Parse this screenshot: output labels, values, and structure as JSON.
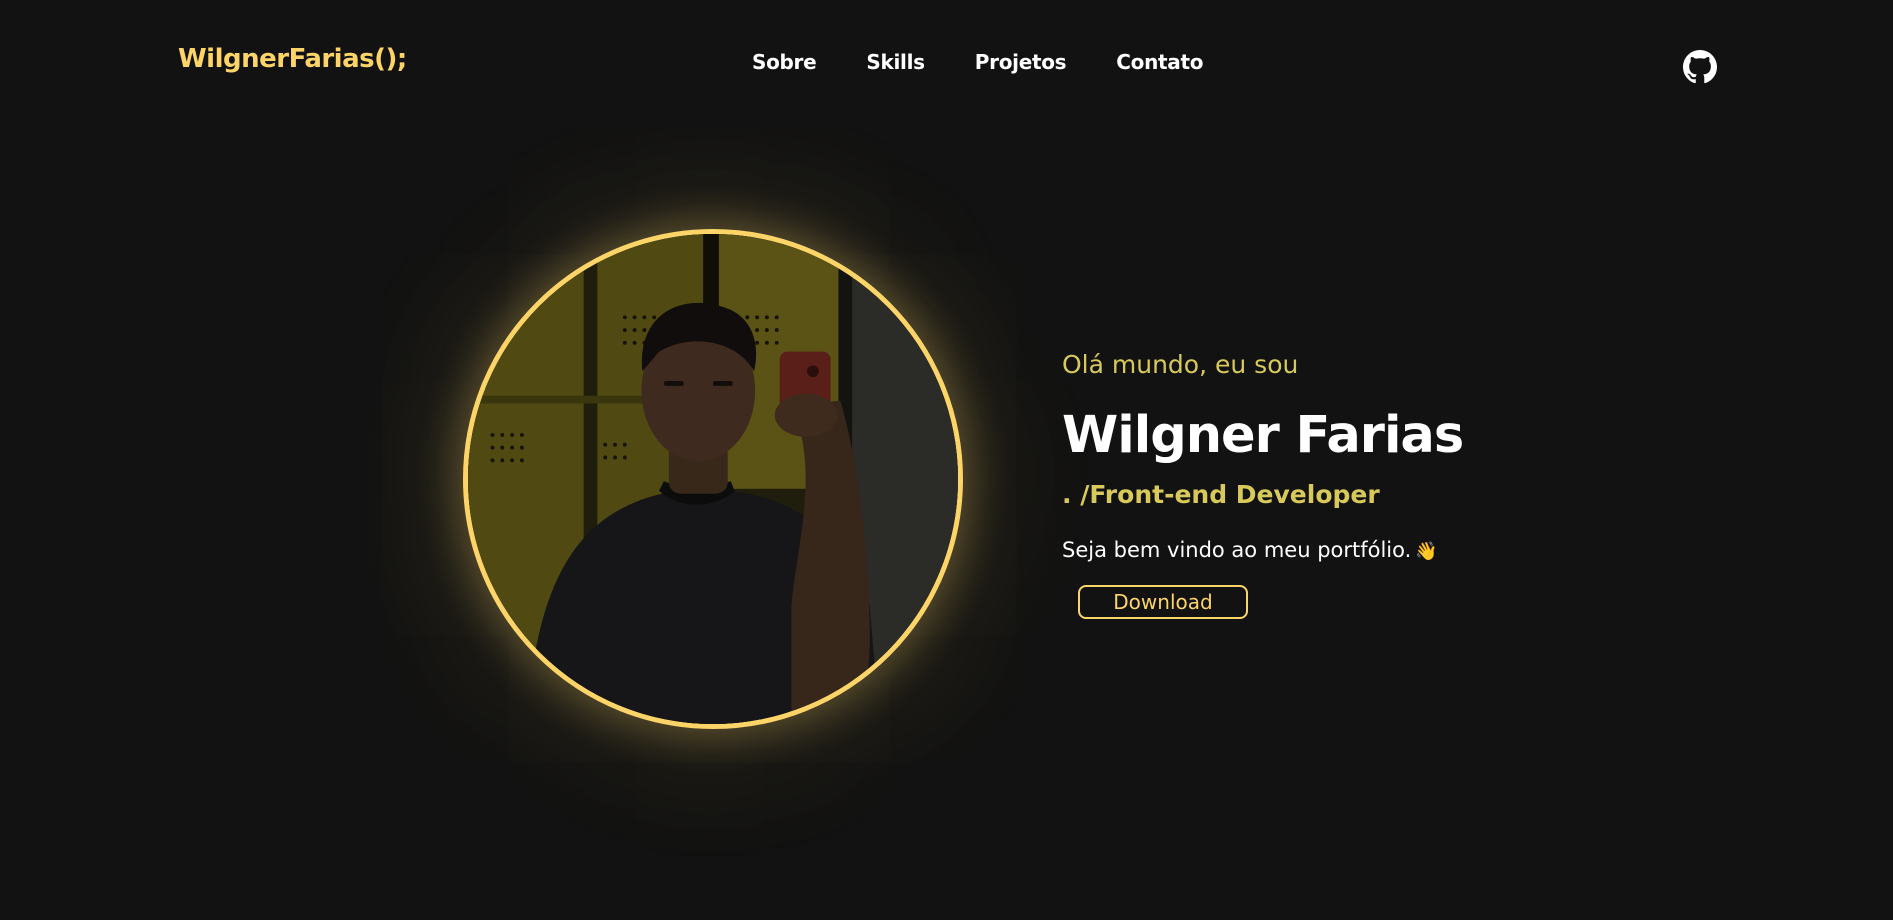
{
  "header": {
    "logo": "WilgnerFarias();",
    "nav": {
      "sobre": "Sobre",
      "skills": "Skills",
      "projetos": "Projetos",
      "contato": "Contato"
    },
    "github_icon": "github-icon"
  },
  "hero": {
    "greeting": "Olá mundo, eu sou",
    "name": "Wilgner Farias",
    "role": ". /Front-end Developer",
    "welcome": "Seja bem vindo ao meu portfólio.",
    "wave_emoji": "👋",
    "download_label": "Download",
    "photo_icon": "profile-photo"
  },
  "colors": {
    "background": "#121212",
    "accent": "#fdd468",
    "accent_muted": "#d7c95a",
    "text": "#ffffff"
  }
}
